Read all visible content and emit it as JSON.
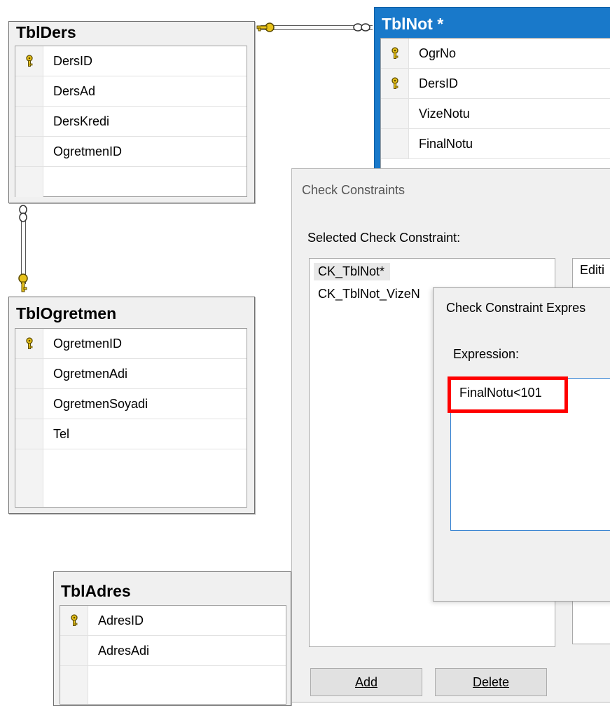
{
  "tables": {
    "tblders": {
      "title": "TblDers",
      "columns": [
        {
          "name": "DersID",
          "key": true
        },
        {
          "name": "DersAd",
          "key": false
        },
        {
          "name": "DersKredi",
          "key": false
        },
        {
          "name": "OgretmenID",
          "key": false
        }
      ]
    },
    "tblnot": {
      "title": "TblNot *",
      "columns": [
        {
          "name": "OgrNo",
          "key": true
        },
        {
          "name": "DersID",
          "key": true
        },
        {
          "name": "VizeNotu",
          "key": false
        },
        {
          "name": "FinalNotu",
          "key": false
        }
      ]
    },
    "tblogretmen": {
      "title": "TblOgretmen",
      "columns": [
        {
          "name": "OgretmenID",
          "key": true
        },
        {
          "name": "OgretmenAdi",
          "key": false
        },
        {
          "name": "OgretmenSoyadi",
          "key": false
        },
        {
          "name": "Tel",
          "key": false
        }
      ]
    },
    "tbladres": {
      "title": "TblAdres",
      "columns": [
        {
          "name": "AdresID",
          "key": true
        },
        {
          "name": "AdresAdi",
          "key": false
        }
      ]
    }
  },
  "check_constraints_dialog": {
    "title": "Check Constraints",
    "selected_label": "Selected Check Constraint:",
    "items": [
      "CK_TblNot*",
      "CK_TblNot_VizeN"
    ],
    "editing_label": "Editi",
    "add_label": "Add",
    "delete_label": "Delete"
  },
  "expression_dialog": {
    "title": "Check Constraint Expres",
    "expression_label": "Expression:",
    "expression_value": "FinalNotu<101"
  },
  "colors": {
    "selected_table": "#1979ca",
    "key_icon": "#e8c21a",
    "highlight": "#ff0000",
    "expression_border": "#2f7fd1"
  }
}
